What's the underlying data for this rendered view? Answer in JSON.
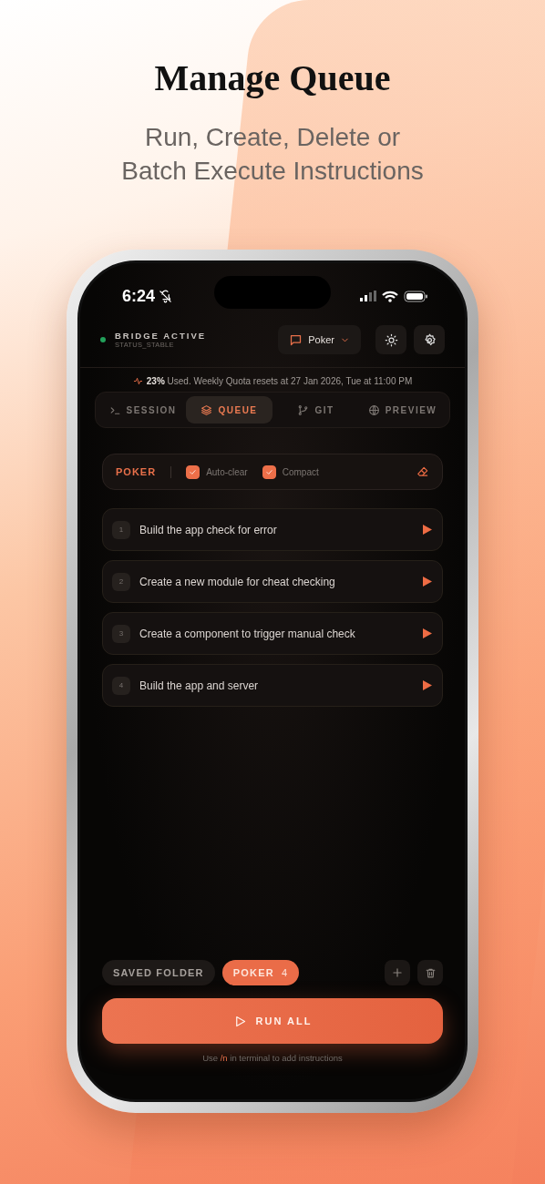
{
  "headline": "Manage Queue",
  "subtitle_lines": [
    "Run, Create, Delete or",
    "Batch Execute Instructions"
  ],
  "status_bar": {
    "time": "6:24"
  },
  "header": {
    "status": {
      "label": "BRIDGE ACTIVE",
      "detail": "STATUS_STABLE",
      "color": "#22a05a"
    },
    "project": "Poker"
  },
  "quota": "**23%** Used. Weekly Quota resets at 27 Jan 2026, Tue at 11:00 PM",
  "tabs": [
    {
      "kind": "terminal",
      "label": "SESSION",
      "selected": false
    },
    {
      "kind": "stack",
      "label": "QUEUE",
      "selected": true
    },
    {
      "kind": "branch",
      "label": "GIT",
      "selected": false
    },
    {
      "kind": "globe",
      "label": "PREVIEW",
      "selected": false
    }
  ],
  "queue_bar": {
    "title": "POKER",
    "options": [
      {
        "label": "Auto-clear",
        "checked": true
      },
      {
        "label": "Compact",
        "checked": true
      }
    ]
  },
  "items": [
    {
      "number": "1",
      "text": "Build the app check for error"
    },
    {
      "number": "2",
      "text": "Create a new module for cheat checking"
    },
    {
      "number": "3",
      "text": "Create a component to trigger manual check"
    },
    {
      "number": "4",
      "text": "Build the app and server"
    }
  ],
  "folders": [
    {
      "label": "SAVED FOLDER",
      "selected": false
    },
    {
      "label": "POKER",
      "count": "4",
      "selected": true
    }
  ],
  "run_button": "RUN ALL",
  "hint": {
    "before": "Use",
    "command": "/n",
    "after": "in terminal to add instructions"
  }
}
